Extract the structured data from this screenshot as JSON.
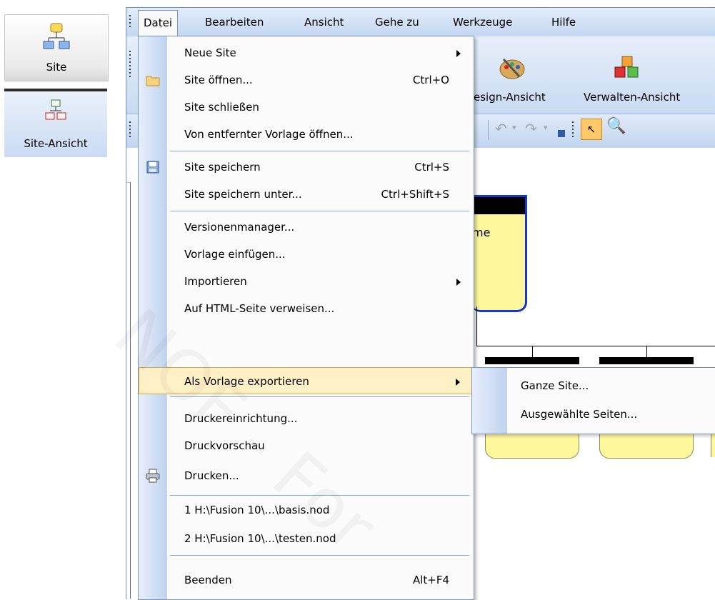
{
  "sidebar": {
    "site_label": "Site",
    "siteansicht_label": "Site-Ansicht"
  },
  "menubar": {
    "items": [
      "Datei",
      "Bearbeiten",
      "Ansicht",
      "Gehe zu",
      "Werkzeuge",
      "Hilfe"
    ],
    "mnemonics": [
      "D",
      "B",
      "A",
      "G",
      "W",
      "H"
    ]
  },
  "toolbar": {
    "design_view_label": "esign-Ansicht",
    "manage_view_label": "Verwalten-Ansicht"
  },
  "canvas": {
    "node_text": "me",
    "watermark": "NOF - For"
  },
  "file_menu": {
    "items": [
      {
        "label": "Neue Site",
        "shortcut": "",
        "submenu": true,
        "icon": ""
      },
      {
        "label": "Site öffnen...",
        "shortcut": "Ctrl+O",
        "submenu": false,
        "icon": "folder-icon"
      },
      {
        "label": "Site schließen",
        "shortcut": "",
        "submenu": false,
        "icon": ""
      },
      {
        "label": "Von entfernter Vorlage öffnen...",
        "shortcut": "",
        "submenu": false,
        "icon": ""
      },
      {
        "label": "Site speichern",
        "shortcut": "Ctrl+S",
        "submenu": false,
        "icon": "save-icon"
      },
      {
        "label": "Site speichern unter...",
        "shortcut": "Ctrl+Shift+S",
        "submenu": false,
        "icon": ""
      },
      {
        "label": "Versionenmanager...",
        "shortcut": "",
        "submenu": false,
        "icon": ""
      },
      {
        "label": "Vorlage einfügen...",
        "shortcut": "",
        "submenu": false,
        "icon": ""
      },
      {
        "label": "Importieren",
        "shortcut": "",
        "submenu": true,
        "icon": ""
      },
      {
        "label": "Auf HTML-Seite verweisen...",
        "shortcut": "",
        "submenu": false,
        "icon": ""
      },
      {
        "label": "Als Vorlage exportieren",
        "shortcut": "",
        "submenu": true,
        "icon": "",
        "highlighted": true
      },
      {
        "label": "Druckereinrichtung...",
        "shortcut": "",
        "submenu": false,
        "icon": ""
      },
      {
        "label": "Druckvorschau",
        "shortcut": "",
        "submenu": false,
        "icon": ""
      },
      {
        "label": "Drucken...",
        "shortcut": "",
        "submenu": false,
        "icon": "printer-icon"
      },
      {
        "label": "1 H:\\Fusion 10\\...\\basis.nod",
        "shortcut": "",
        "submenu": false,
        "icon": ""
      },
      {
        "label": "2 H:\\Fusion 10\\...\\testen.nod",
        "shortcut": "",
        "submenu": false,
        "icon": ""
      },
      {
        "label": "Beenden",
        "shortcut": "Alt+F4",
        "submenu": false,
        "icon": ""
      }
    ]
  },
  "export_submenu": {
    "items": [
      "Ganze Site...",
      "Ausgewählte Seiten..."
    ]
  },
  "colors": {
    "highlight_bg": "#fff0c6",
    "highlight_border": "#d8a84e",
    "node_fill": "#fff79c",
    "menubar_blue": "#c3d6f1"
  }
}
